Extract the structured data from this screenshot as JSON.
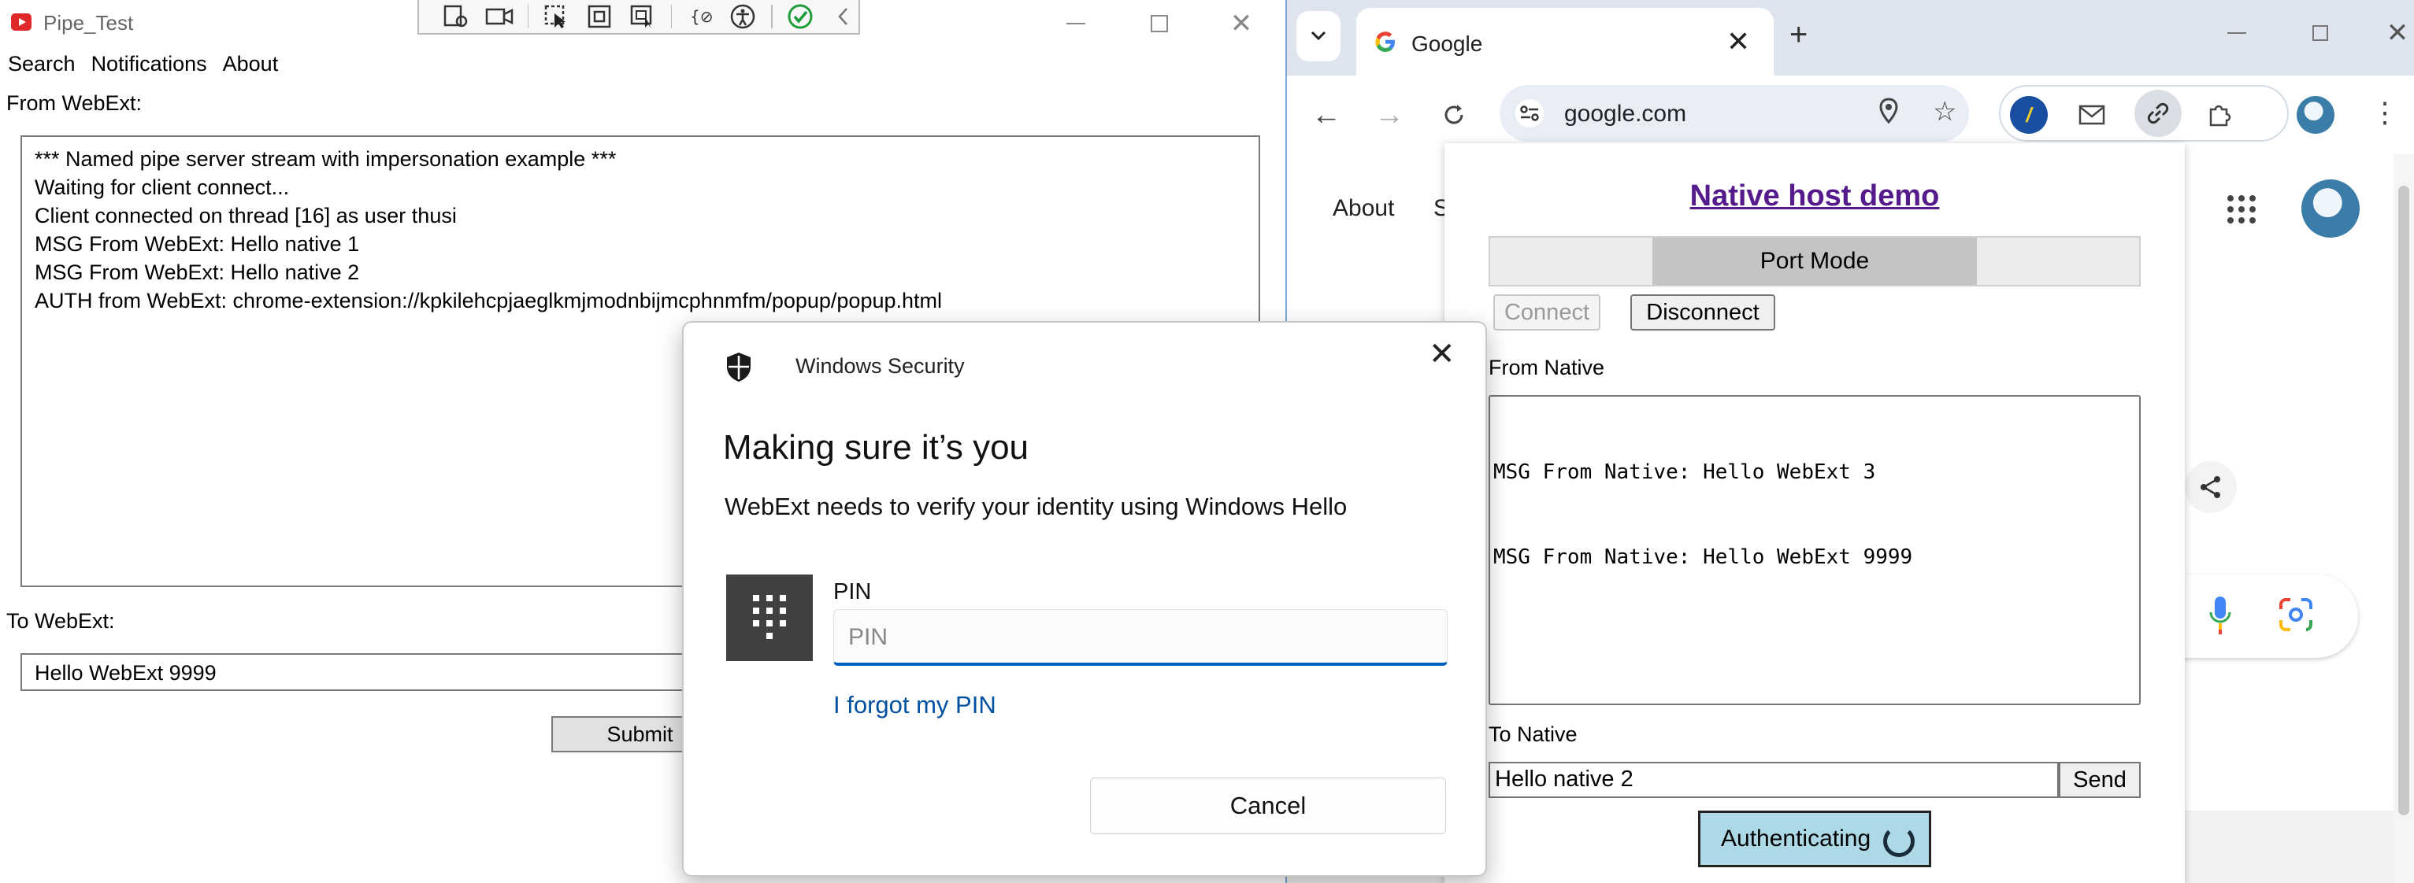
{
  "pipe_test": {
    "title": "Pipe_Test",
    "menu": [
      "Search",
      "Notifications",
      "About"
    ],
    "from_label": "From WebExt:",
    "log_lines": [
      "*** Named pipe server stream with impersonation example ***",
      "Waiting for client connect...",
      "Client connected on thread [16] as user thusi",
      "MSG From WebExt: Hello native 1",
      "MSG From WebExt: Hello native 2",
      "AUTH from WebExt: chrome-extension://kpkilehcpjaeglkmjmodnbijmcphnmfm/popup/popup.html"
    ],
    "to_label": "To WebExt:",
    "to_value": "Hello WebExt 9999",
    "submit_label": "Submit"
  },
  "chrome": {
    "tab_title": "Google",
    "url": "google.com",
    "page_links": [
      "About",
      "S"
    ]
  },
  "popup": {
    "title": "Native host demo",
    "mode": "Port Mode",
    "connect_label": "Connect",
    "disconnect_label": "Disconnect",
    "from_label": "From Native",
    "from_lines": [
      "MSG From Native: Hello WebExt 3",
      "MSG From Native: Hello WebExt 9999"
    ],
    "to_label": "To Native",
    "to_value": "Hello native 2",
    "send_label": "Send",
    "auth_label": "Authenticating"
  },
  "winsec": {
    "title": "Windows Security",
    "heading": "Making sure it’s you",
    "description": "WebExt needs to verify your identity using Windows Hello",
    "pin_label": "PIN",
    "pin_placeholder": "PIN",
    "forgot_link": "I forgot my PIN",
    "cancel_label": "Cancel"
  },
  "icons": {
    "app": "app-icon",
    "shield": "shield-icon",
    "keypad": "keypad-icon"
  }
}
